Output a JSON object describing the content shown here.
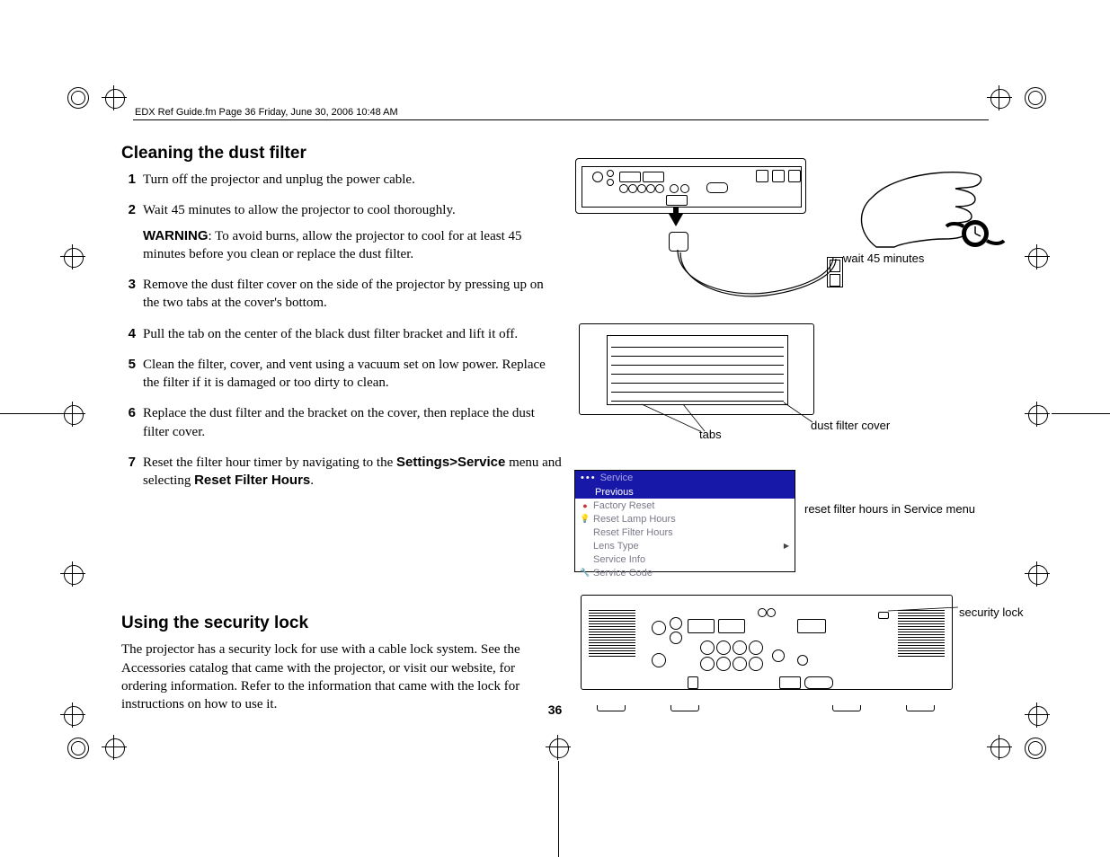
{
  "header": {
    "running_head": "EDX Ref Guide.fm  Page 36  Friday, June 30, 2006  10:48 AM"
  },
  "section1": {
    "title": "Cleaning the dust filter",
    "steps": {
      "s1": "Turn off the projector and unplug the power cable.",
      "s2": "Wait 45 minutes to allow the projector to cool thoroughly.",
      "warning_label": "WARNING",
      "warning_text": ": To avoid burns, allow the projector to cool for at least 45 minutes before you clean or replace the dust filter.",
      "s3": "Remove the dust filter cover on the side of the projector by pressing up on the two tabs at the cover's bottom.",
      "s4": "Pull the tab on the center of the black dust filter bracket and lift it off.",
      "s5": "Clean the filter, cover, and vent using a vacuum set on low power. Replace the filter if it is damaged or too dirty to clean.",
      "s6": "Replace the dust filter and the bracket on the cover, then replace the dust filter cover.",
      "s7_a": "Reset the filter hour timer by navigating to the ",
      "s7_b": "Settings>Service",
      "s7_c": " menu and selecting ",
      "s7_d": "Reset Filter Hours",
      "s7_e": "."
    }
  },
  "section2": {
    "title": "Using the security lock",
    "body": "The projector has a security lock for use with a cable lock system. See the Accessories catalog that came with the projector, or visit our website, for ordering information. Refer to the information that came with the lock for instructions on how to use it."
  },
  "labels": {
    "wait": "wait 45 minutes",
    "tabs": "tabs",
    "dust_filter_cover": "dust filter cover",
    "svc_caption": "reset filter hours in Service menu",
    "security_lock": "security lock"
  },
  "service_menu": {
    "title": "Service",
    "items": {
      "previous": "Previous",
      "factory_reset": "Factory Reset",
      "reset_lamp": "Reset Lamp Hours",
      "reset_filter": "Reset Filter Hours",
      "lens_type": "Lens Type",
      "service_info": "Service Info",
      "service_code": "Service Code"
    }
  },
  "page_number": "36"
}
